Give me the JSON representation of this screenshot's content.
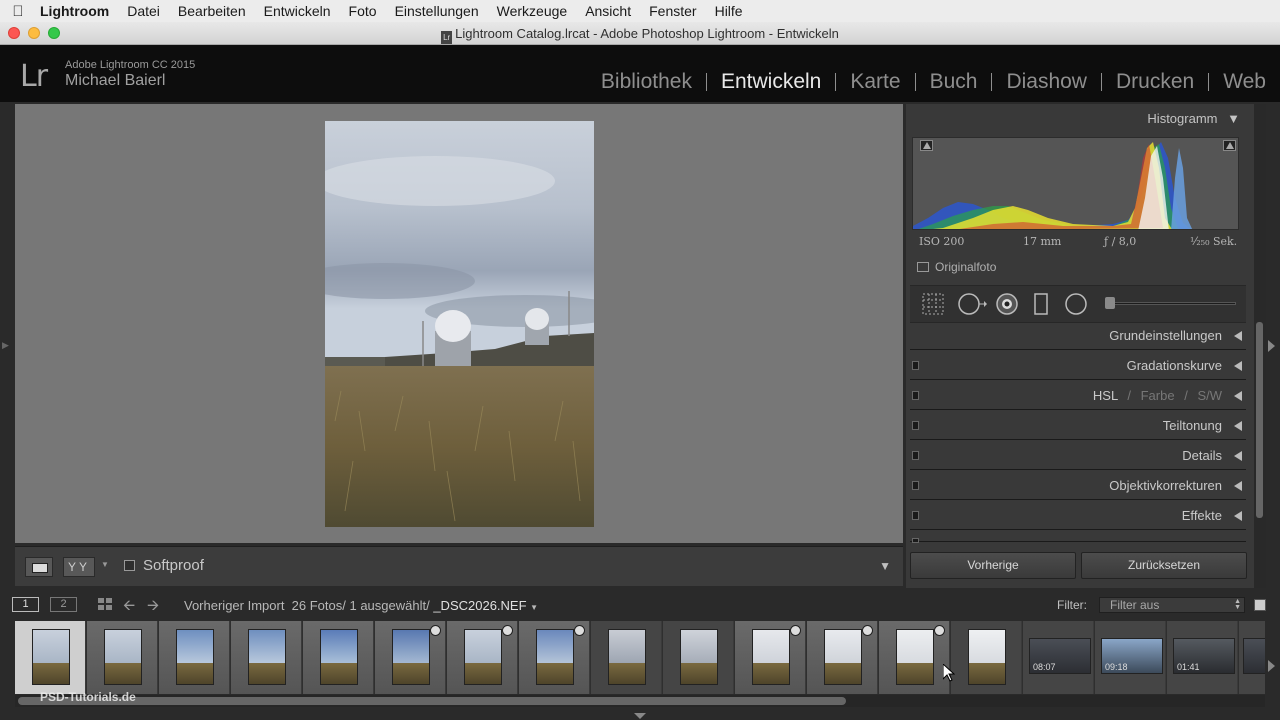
{
  "menubar": {
    "app": "Lightroom",
    "items": [
      "Datei",
      "Bearbeiten",
      "Entwickeln",
      "Foto",
      "Einstellungen",
      "Werkzeuge",
      "Ansicht",
      "Fenster",
      "Hilfe"
    ]
  },
  "window": {
    "title": "Lightroom Catalog.lrcat - Adobe Photoshop Lightroom - Entwickeln"
  },
  "identity": {
    "logo": "Lr",
    "app": "Adobe Lightroom CC 2015",
    "user": "Michael Baierl"
  },
  "modules": {
    "items": [
      "Bibliothek",
      "Entwickeln",
      "Karte",
      "Buch",
      "Diashow",
      "Drucken",
      "Web"
    ],
    "active": "Entwickeln"
  },
  "toolbar": {
    "yy": "YY",
    "softproof": "Softproof"
  },
  "histogram": {
    "title": "Histogramm",
    "iso": "ISO 200",
    "focal": "17 mm",
    "aperture": "ƒ / 8,0",
    "shutter": "¹⁄₂₅₀ Sek.",
    "original": "Originalfoto"
  },
  "panels": {
    "grundeinstellungen": "Grundeinstellungen",
    "gradationskurve": "Gradationskurve",
    "hsl": "HSL",
    "slash": "/",
    "farbe": "Farbe",
    "sw": "S/W",
    "teiltonung": "Teiltonung",
    "details": "Details",
    "objektiv": "Objektivkorrekturen",
    "effekte": "Effekte"
  },
  "buttons": {
    "previous": "Vorherige",
    "reset": "Zurücksetzen"
  },
  "filmstrip_header": {
    "monitor1": "1",
    "monitor2": "2",
    "source": "Vorheriger Import",
    "count": "26 Fotos/ 1 ausgewählt/",
    "file": "_DSC2026.NEF",
    "filter_label": "Filter:",
    "filter_value": "Filter aus"
  },
  "filmstrip": {
    "durations": [
      "08:07",
      "09:18",
      "01:41"
    ],
    "watermark": "PSD-Tutorials.de"
  },
  "colors": {
    "accent": "#e8e8e8",
    "panel": "#393939",
    "loupe_bg": "#777777"
  }
}
